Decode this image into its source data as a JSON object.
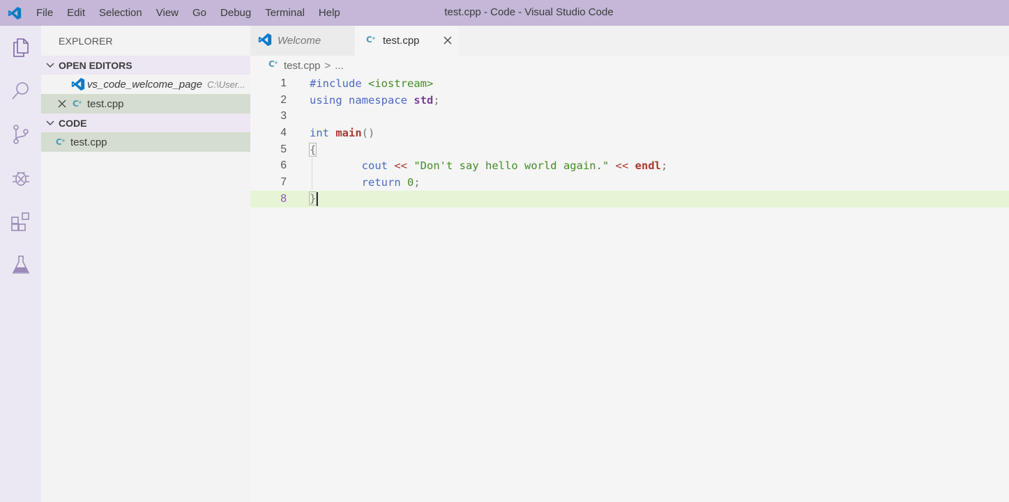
{
  "titlebar": {
    "title": "test.cpp - Code - Visual Studio Code",
    "menu": [
      "File",
      "Edit",
      "Selection",
      "View",
      "Go",
      "Debug",
      "Terminal",
      "Help"
    ]
  },
  "activity_bar": {
    "items": [
      "explorer-icon",
      "search-icon",
      "source-control-icon",
      "debug-icon",
      "extensions-icon",
      "test-flask-icon"
    ]
  },
  "sidebar": {
    "title": "EXPLORER",
    "open_editors": {
      "header": "OPEN EDITORS",
      "items": [
        {
          "name": "vs_code_welcome_page",
          "hint": "C:\\User...",
          "icon": "vscode-icon"
        },
        {
          "name": "test.cpp",
          "icon": "cpp-file-icon",
          "selected": true
        }
      ]
    },
    "folder": {
      "header": "CODE",
      "items": [
        {
          "name": "test.cpp",
          "icon": "cpp-file-icon",
          "selected": true
        }
      ]
    }
  },
  "editor": {
    "tabs": [
      {
        "label": "Welcome",
        "icon": "vscode-icon",
        "active": false
      },
      {
        "label": "test.cpp",
        "icon": "cpp-file-icon",
        "active": true
      }
    ],
    "breadcrumb": {
      "file": "test.cpp",
      "sep": ">",
      "rest": "..."
    },
    "line_numbers": [
      "1",
      "2",
      "3",
      "4",
      "5",
      "6",
      "7",
      "8"
    ],
    "current_line": 8,
    "code": {
      "l1": [
        "#include",
        "<iostream>"
      ],
      "l2": [
        "using",
        "namespace",
        "std",
        ";"
      ],
      "l4": [
        "int",
        "main",
        "()"
      ],
      "l5": [
        "{"
      ],
      "l6": [
        "cout",
        "<<",
        "\"Don't say hello world again.\"",
        "<<",
        "endl",
        ";"
      ],
      "l7": [
        "return",
        "0",
        ";"
      ],
      "l8": [
        "}"
      ]
    }
  },
  "colors": {
    "titlebar": "#c4b7d7",
    "activitybar": "#ebe8f3",
    "selection": "#d4ddcf",
    "current_line": "#e6f5d5"
  }
}
